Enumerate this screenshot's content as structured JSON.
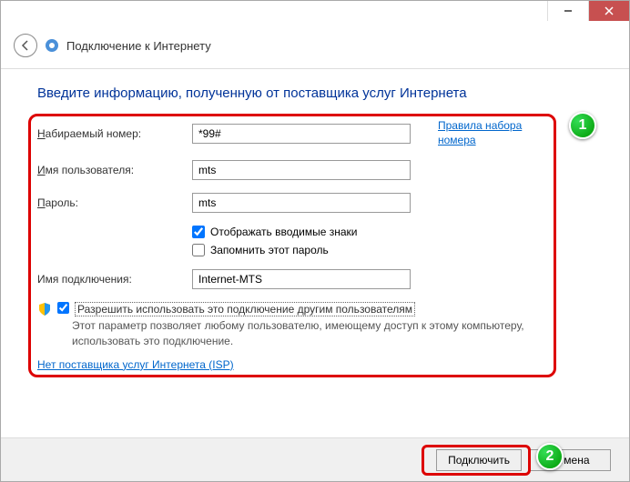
{
  "window": {
    "title": "Подключение к Интернету"
  },
  "page": {
    "heading": "Введите информацию, полученную от поставщика услуг Интернета"
  },
  "form": {
    "dial_label_pre": "Н",
    "dial_label": "абираемый номер:",
    "dial_value": "*99#",
    "dial_rules_link1": "Правила набора",
    "dial_rules_link2": "номера",
    "user_label_pre": "И",
    "user_label": "мя пользователя:",
    "user_value": "mts",
    "pass_label_pre": "П",
    "pass_label": "ароль:",
    "pass_value": "mts",
    "show_chars_label": "Отображать вводимые знаки",
    "remember_label": "Запомнить этот пароль",
    "conn_label": "Имя подключения:",
    "conn_value": "Internet-MTS",
    "share_label": "Разрешить использовать это подключение другим пользователям",
    "share_desc": "Этот параметр позволяет любому пользователю, имеющему доступ к этому компьютеру, использовать это подключение.",
    "isp_link": "Нет поставщика услуг Интернета (ISP)"
  },
  "footer": {
    "connect": "Подключить",
    "cancel": "Отмена"
  },
  "badges": {
    "b1": "1",
    "b2": "2"
  }
}
